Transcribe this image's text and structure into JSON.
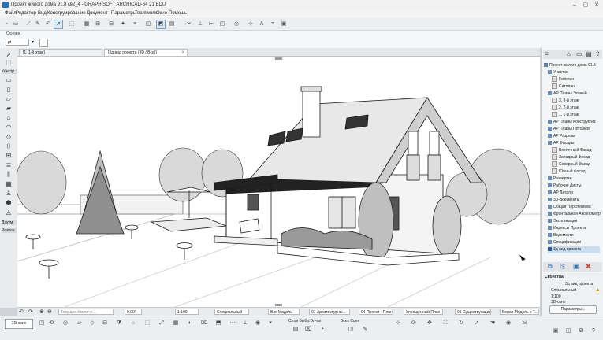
{
  "window": {
    "title": "Проект жилого дома 91.8 кв2_4 - GRAPHISOFT ARCHICAD-64 21 EDU",
    "minimize": "–",
    "maximize": "▢",
    "close": "✕"
  },
  "menu": [
    "Файл",
    "Редактор",
    "Вид",
    "Конструирование",
    "Документ",
    "Параметры",
    "Teamwork",
    "Окно",
    "Помощь"
  ],
  "infobox": {
    "label": "Основн.",
    "select": "pt"
  },
  "toolbox": {
    "section_construct": "Констр",
    "section_document": "Докум",
    "section_misc": "Разное"
  },
  "tabs": [
    {
      "label": "[1. 1-й этаж]"
    },
    {
      "label": "[3д вид проекта (3D / Все)]"
    }
  ],
  "navigator": {
    "items": [
      {
        "label": "Проект жилого дома 91.8"
      },
      {
        "label": "Участок"
      },
      {
        "label": "Генплан"
      },
      {
        "label": "Ситплан"
      },
      {
        "label": "АР Планы Этажей"
      },
      {
        "label": "3. 3-й этаж"
      },
      {
        "label": "2. 2-й этаж"
      },
      {
        "label": "1. 1-й этаж"
      },
      {
        "label": "АР Планы Конструктив"
      },
      {
        "label": "АР Планы Потолков"
      },
      {
        "label": "АР Разрезы"
      },
      {
        "label": "АР Фасады"
      },
      {
        "label": "Восточный Фасад"
      },
      {
        "label": "Западный Фасад"
      },
      {
        "label": "Северный Фасад"
      },
      {
        "label": "Южный Фасад"
      },
      {
        "label": "Развертки"
      },
      {
        "label": "Рабочие Листы"
      },
      {
        "label": "АР Детали"
      },
      {
        "label": "3D-документы"
      },
      {
        "label": "Общая Перспектива"
      },
      {
        "label": "Фронтальная Аксонометр"
      },
      {
        "label": "Экспликации"
      },
      {
        "label": "Индексы Проекта"
      },
      {
        "label": "Ведомости"
      },
      {
        "label": "Спецификации"
      },
      {
        "label": "3д вид проекта"
      }
    ]
  },
  "properties": {
    "header": "Свойства",
    "name": "3д вид проекта",
    "layer": "Специальный",
    "scale": "1:100",
    "mode": "3D-окно",
    "button": "Параметры..."
  },
  "statusbar": {
    "zoom_hint": "Текущее Увеличе...",
    "angle": "0,00°",
    "scale": "1:100",
    "layer": "Специальный",
    "model": "Вся Модель",
    "arch": "01 Архитектурны...",
    "plan": "04 Проект - Планы",
    "simplified": "Упрощенный План",
    "existing": "01 Существующие...",
    "white_model": "Белая Модель с Т..."
  },
  "bottom": {
    "tab3d": "3D-окно",
    "layers_hint": "Слои Выбр.Эл-ов",
    "all_scenes": "Всех Сцен"
  }
}
